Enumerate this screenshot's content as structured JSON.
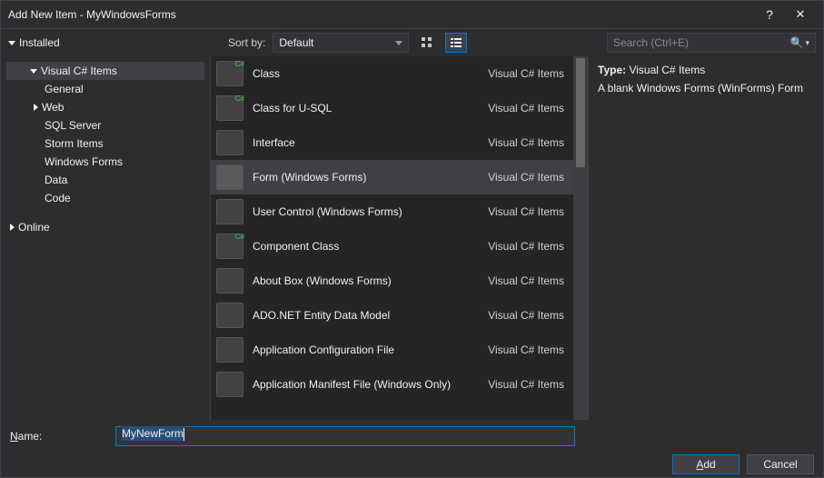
{
  "title": "Add New Item - MyWindowsForms",
  "tree": {
    "installed": "Installed",
    "csitems": "Visual C# Items",
    "general": "General",
    "web": "Web",
    "sql": "SQL Server",
    "storm": "Storm Items",
    "winforms": "Windows Forms",
    "data": "Data",
    "code": "Code",
    "online": "Online"
  },
  "sort": {
    "label": "Sort by:",
    "value": "Default"
  },
  "search": {
    "placeholder": "Search (Ctrl+E)"
  },
  "items": [
    {
      "name": "Class",
      "lang": "Visual C# Items",
      "cs": true
    },
    {
      "name": "Class for U-SQL",
      "lang": "Visual C# Items",
      "cs": true
    },
    {
      "name": "Interface",
      "lang": "Visual C# Items",
      "cs": false
    },
    {
      "name": "Form (Windows Forms)",
      "lang": "Visual C# Items",
      "cs": false,
      "selected": true
    },
    {
      "name": "User Control (Windows Forms)",
      "lang": "Visual C# Items",
      "cs": false
    },
    {
      "name": "Component Class",
      "lang": "Visual C# Items",
      "cs": true
    },
    {
      "name": "About Box (Windows Forms)",
      "lang": "Visual C# Items",
      "cs": false
    },
    {
      "name": "ADO.NET Entity Data Model",
      "lang": "Visual C# Items",
      "cs": false
    },
    {
      "name": "Application Configuration File",
      "lang": "Visual C# Items",
      "cs": false
    },
    {
      "name": "Application Manifest File (Windows Only)",
      "lang": "Visual C# Items",
      "cs": false
    }
  ],
  "details": {
    "type_label": "Type:",
    "type_value": "Visual C# Items",
    "desc": "A blank Windows Forms (WinForms) Form"
  },
  "name_field": {
    "label_pre": "N",
    "label_rest": "ame:",
    "value": "MyNewForm"
  },
  "buttons": {
    "add_pre": "A",
    "add_rest": "dd",
    "cancel": "Cancel"
  }
}
